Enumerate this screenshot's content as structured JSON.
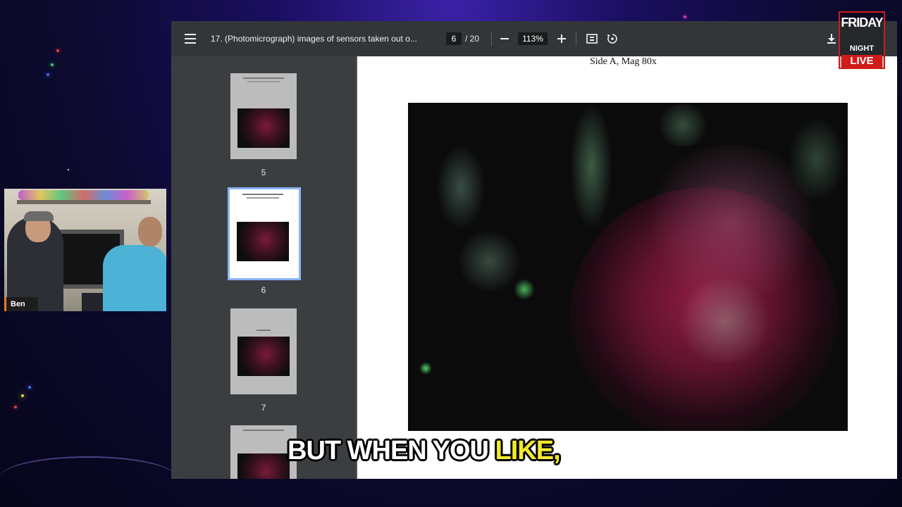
{
  "viewer": {
    "doc_title": "17. (Photomicrograph) images of sensors taken out o...",
    "current_page": "6",
    "total_pages": "/ 20",
    "zoom": "113%",
    "icons": [
      "menu-icon",
      "minus-icon",
      "plus-icon",
      "fit-page-icon",
      "rotate-icon",
      "download-icon"
    ]
  },
  "sidebar": {
    "thumbnails": [
      {
        "label": "5"
      },
      {
        "label": "6"
      },
      {
        "label": "7"
      },
      {
        "label": ""
      }
    ]
  },
  "page": {
    "caption": "Side A, Mag 80x"
  },
  "webcam": {
    "name": "Ben"
  },
  "branding": {
    "line1": "FRIDAY",
    "line2": "NIGHT",
    "line3": "LIVE"
  },
  "subtitle": {
    "part1": "BUT WHEN YOU ",
    "highlight": "LIKE,"
  },
  "colors": {
    "toolbar": "#323639",
    "sidebar": "#3b3e41",
    "selected_thumb_border": "#8ab4f8",
    "caption_highlight": "#f2ea2c",
    "logo_red": "#d11b1b"
  }
}
